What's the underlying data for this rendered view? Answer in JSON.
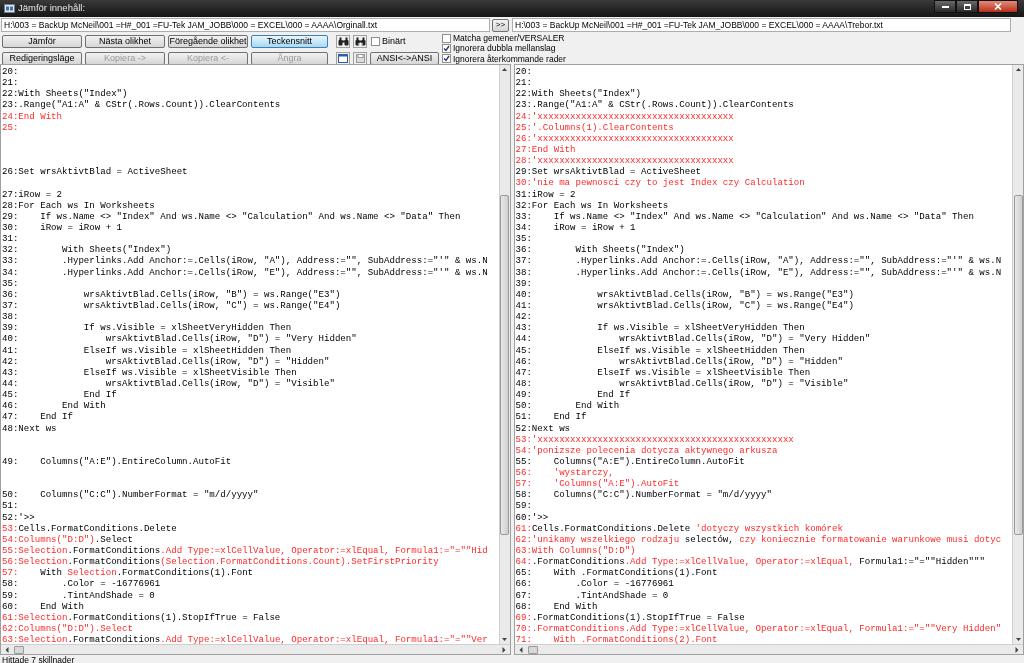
{
  "window": {
    "title": "Jämför innehåll:"
  },
  "paths": [
    {
      "value": "H:\\003 = BackUp McNeil\\001 =H#_001 =FU-Tek JAM_JOBB\\000 = EXCEL\\000 = AAAA\\Orginall.txt",
      "button": ">>"
    },
    {
      "value": "H:\\003 = BackUp McNeil\\001 =H#_001 =FU-Tek JAM_JOBB\\000 = EXCEL\\000 = AAAA\\Trebor.txt"
    }
  ],
  "toolbar_rows": [
    {
      "buttons": [
        {
          "label": "Jämför",
          "disabled": false,
          "focused": false
        },
        {
          "label": "Nästa olikhet",
          "disabled": false,
          "focused": false
        },
        {
          "label": "Föregående olikhet",
          "disabled": false,
          "focused": false
        },
        {
          "label": "Teckensnitt",
          "disabled": false,
          "focused": true
        }
      ],
      "checkbox": {
        "label": "Binärt",
        "checked": false
      }
    },
    {
      "buttons": [
        {
          "label": "Redigeringsläge",
          "disabled": false,
          "focused": false
        },
        {
          "label": "Kopiera ->",
          "disabled": true,
          "focused": false
        },
        {
          "label": "Kopiera <-",
          "disabled": true,
          "focused": false
        },
        {
          "label": "Ångra",
          "disabled": true,
          "focused": false
        }
      ],
      "extra_button": {
        "label": "ANSI<->ANSI"
      }
    }
  ],
  "options": [
    {
      "label": "Matcha gemener/VERSALER",
      "checked": false
    },
    {
      "label": "Ignorera dubbla mellanslag",
      "checked": true
    },
    {
      "label": "Ignorera återkommande rader",
      "checked": true
    }
  ],
  "panes": [
    {
      "lines": [
        {
          "kind": "line",
          "segments": [
            {
              "text": "20:",
              "changed": false
            }
          ]
        },
        {
          "kind": "line",
          "segments": [
            {
              "text": "21:",
              "changed": false
            }
          ]
        },
        {
          "kind": "line",
          "segments": [
            {
              "text": "22:With Sheets(\"Index\")",
              "changed": false
            }
          ]
        },
        {
          "kind": "line",
          "segments": [
            {
              "text": "23:.Range(\"A1:A\" & CStr(.Rows.Count)).ClearContents",
              "changed": false
            }
          ]
        },
        {
          "kind": "line",
          "segments": [
            {
              "text": "24:End With",
              "changed": true
            }
          ]
        },
        {
          "kind": "line",
          "segments": [
            {
              "text": "25:",
              "changed": true
            }
          ]
        },
        {
          "kind": "gap"
        },
        {
          "kind": "gap"
        },
        {
          "kind": "gap"
        },
        {
          "kind": "line",
          "segments": [
            {
              "text": "26:Set wrsAktivtBlad = ActiveSheet",
              "changed": false
            }
          ]
        },
        {
          "kind": "gap"
        },
        {
          "kind": "line",
          "segments": [
            {
              "text": "27:iRow = 2",
              "changed": false
            }
          ]
        },
        {
          "kind": "line",
          "segments": [
            {
              "text": "28:For Each ws In Worksheets",
              "changed": false
            }
          ]
        },
        {
          "kind": "line",
          "segments": [
            {
              "text": "29:    If ws.Name <> \"Index\" And ws.Name <> \"Calculation\" And ws.Name <> \"Data\" Then",
              "changed": false
            }
          ]
        },
        {
          "kind": "line",
          "segments": [
            {
              "text": "30:    iRow = iRow + 1",
              "changed": false
            }
          ]
        },
        {
          "kind": "line",
          "segments": [
            {
              "text": "31:",
              "changed": false
            }
          ]
        },
        {
          "kind": "line",
          "segments": [
            {
              "text": "32:        With Sheets(\"Index\")",
              "changed": false
            }
          ]
        },
        {
          "kind": "line",
          "segments": [
            {
              "text": "33:        .Hyperlinks.Add Anchor:=.Cells(iRow, \"A\"), Address:=\"\", SubAddress:=\"'\" & ws.N",
              "changed": false
            }
          ]
        },
        {
          "kind": "line",
          "segments": [
            {
              "text": "34:        .Hyperlinks.Add Anchor:=.Cells(iRow, \"E\"), Address:=\"\", SubAddress:=\"'\" & ws.N",
              "changed": false
            }
          ]
        },
        {
          "kind": "line",
          "segments": [
            {
              "text": "35:",
              "changed": false
            }
          ]
        },
        {
          "kind": "line",
          "segments": [
            {
              "text": "36:            wrsAktivtBlad.Cells(iRow, \"B\") = ws.Range(\"E3\")",
              "changed": false
            }
          ]
        },
        {
          "kind": "line",
          "segments": [
            {
              "text": "37:            wrsAktivtBlad.Cells(iRow, \"C\") = ws.Range(\"E4\")",
              "changed": false
            }
          ]
        },
        {
          "kind": "line",
          "segments": [
            {
              "text": "38:",
              "changed": false
            }
          ]
        },
        {
          "kind": "line",
          "segments": [
            {
              "text": "39:            If ws.Visible = xlSheetVeryHidden Then",
              "changed": false
            }
          ]
        },
        {
          "kind": "line",
          "segments": [
            {
              "text": "40:                wrsAktivtBlad.Cells(iRow, \"D\") = \"Very Hidden\"",
              "changed": false
            }
          ]
        },
        {
          "kind": "line",
          "segments": [
            {
              "text": "41:            ElseIf ws.Visible = xlSheetHidden Then",
              "changed": false
            }
          ]
        },
        {
          "kind": "line",
          "segments": [
            {
              "text": "42:                wrsAktivtBlad.Cells(iRow, \"D\") = \"Hidden\"",
              "changed": false
            }
          ]
        },
        {
          "kind": "line",
          "segments": [
            {
              "text": "43:            ElseIf ws.Visible = xlSheetVisible Then",
              "changed": false
            }
          ]
        },
        {
          "kind": "line",
          "segments": [
            {
              "text": "44:                wrsAktivtBlad.Cells(iRow, \"D\") = \"Visible\"",
              "changed": false
            }
          ]
        },
        {
          "kind": "line",
          "segments": [
            {
              "text": "45:            End If",
              "changed": false
            }
          ]
        },
        {
          "kind": "line",
          "segments": [
            {
              "text": "46:        End With",
              "changed": false
            }
          ]
        },
        {
          "kind": "line",
          "segments": [
            {
              "text": "47:    End If",
              "changed": false
            }
          ]
        },
        {
          "kind": "line",
          "segments": [
            {
              "text": "48:Next ws",
              "changed": false
            }
          ]
        },
        {
          "kind": "gap"
        },
        {
          "kind": "gap"
        },
        {
          "kind": "line",
          "segments": [
            {
              "text": "49:    Columns(\"A:E\").EntireColumn.AutoFit",
              "changed": false
            }
          ]
        },
        {
          "kind": "gap"
        },
        {
          "kind": "gap"
        },
        {
          "kind": "line",
          "segments": [
            {
              "text": "50:    Columns(\"C:C\").NumberFormat = \"m/d/yyyy\"",
              "changed": false
            }
          ]
        },
        {
          "kind": "line",
          "segments": [
            {
              "text": "51:",
              "changed": false
            }
          ]
        },
        {
          "kind": "line",
          "segments": [
            {
              "text": "52:'>>",
              "changed": false
            }
          ]
        },
        {
          "kind": "line",
          "segments": [
            {
              "text": "53:",
              "changed": true
            },
            {
              "text": "Cells.FormatConditions.Delete",
              "changed": false
            }
          ]
        },
        {
          "kind": "line",
          "segments": [
            {
              "text": "54:Columns(\"D:D\")",
              "changed": true
            },
            {
              "text": ".Select",
              "changed": false
            }
          ]
        },
        {
          "kind": "line",
          "segments": [
            {
              "text": "55:Selection",
              "changed": true
            },
            {
              "text": ".FormatConditions",
              "changed": false
            },
            {
              "text": ".Add Type:=xlCellValue, Operator:=xlEqual, Formula1:=\"=\"\"Hid",
              "changed": true
            }
          ]
        },
        {
          "kind": "line",
          "segments": [
            {
              "text": "56:Selection",
              "changed": true
            },
            {
              "text": ".FormatConditions",
              "changed": false
            },
            {
              "text": "(Selection.FormatConditions.Count).SetFirstPriority",
              "changed": true
            }
          ]
        },
        {
          "kind": "line",
          "segments": [
            {
              "text": "57:",
              "changed": true
            },
            {
              "text": "    With ",
              "changed": false
            },
            {
              "text": "Selection",
              "changed": true
            },
            {
              "text": ".FormatConditions(1).Font",
              "changed": false
            }
          ]
        },
        {
          "kind": "line",
          "segments": [
            {
              "text": "58:        .Color = -16776961",
              "changed": false
            }
          ]
        },
        {
          "kind": "line",
          "segments": [
            {
              "text": "59:        .TintAndShade = 0",
              "changed": false
            }
          ]
        },
        {
          "kind": "line",
          "segments": [
            {
              "text": "60:    End With",
              "changed": false
            }
          ]
        },
        {
          "kind": "line",
          "segments": [
            {
              "text": "61:Selection",
              "changed": true
            },
            {
              "text": ".FormatConditions(1).StopIfTrue = False",
              "changed": false
            }
          ]
        },
        {
          "kind": "line",
          "segments": [
            {
              "text": "62:Columns(\"D:D\").Select",
              "changed": true
            }
          ]
        },
        {
          "kind": "line",
          "segments": [
            {
              "text": "63:Selection",
              "changed": true
            },
            {
              "text": ".FormatConditions",
              "changed": false
            },
            {
              "text": ".Add Type:=xlCellValue, Operator:=xlEqual, Formula1:=\"=\"\"Ver",
              "changed": true
            }
          ]
        }
      ]
    },
    {
      "lines": [
        {
          "kind": "line",
          "segments": [
            {
              "text": "20:",
              "changed": false
            }
          ]
        },
        {
          "kind": "line",
          "segments": [
            {
              "text": "21:",
              "changed": false
            }
          ]
        },
        {
          "kind": "line",
          "segments": [
            {
              "text": "22:With Sheets(\"Index\")",
              "changed": false
            }
          ]
        },
        {
          "kind": "line",
          "segments": [
            {
              "text": "23:.Range(\"A1:A\" & CStr(.Rows.Count)).ClearContents",
              "changed": false
            }
          ]
        },
        {
          "kind": "line",
          "segments": [
            {
              "text": "24:'xxxxxxxxxxxxxxxxxxxxxxxxxxxxxxxxxxxx",
              "changed": true
            }
          ]
        },
        {
          "kind": "line",
          "segments": [
            {
              "text": "25:'.Columns(1).ClearContents",
              "changed": true
            }
          ]
        },
        {
          "kind": "line",
          "segments": [
            {
              "text": "26:'xxxxxxxxxxxxxxxxxxxxxxxxxxxxxxxxxxxx",
              "changed": true
            }
          ]
        },
        {
          "kind": "line",
          "segments": [
            {
              "text": "27:End With",
              "changed": true
            }
          ]
        },
        {
          "kind": "line",
          "segments": [
            {
              "text": "28:'xxxxxxxxxxxxxxxxxxxxxxxxxxxxxxxxxxxx",
              "changed": true
            }
          ]
        },
        {
          "kind": "line",
          "segments": [
            {
              "text": "29:Set wrsAktivtBlad = ActiveSheet",
              "changed": false
            }
          ]
        },
        {
          "kind": "line",
          "segments": [
            {
              "text": "30:'nie ma pewnosci czy to jest Index czy Calculation",
              "changed": true
            }
          ]
        },
        {
          "kind": "line",
          "segments": [
            {
              "text": "31:iRow = 2",
              "changed": false
            }
          ]
        },
        {
          "kind": "line",
          "segments": [
            {
              "text": "32:For Each ws In Worksheets",
              "changed": false
            }
          ]
        },
        {
          "kind": "line",
          "segments": [
            {
              "text": "33:    If ws.Name <> \"Index\" And ws.Name <> \"Calculation\" And ws.Name <> \"Data\" Then",
              "changed": false
            }
          ]
        },
        {
          "kind": "line",
          "segments": [
            {
              "text": "34:    iRow = iRow + 1",
              "changed": false
            }
          ]
        },
        {
          "kind": "line",
          "segments": [
            {
              "text": "35:",
              "changed": false
            }
          ]
        },
        {
          "kind": "line",
          "segments": [
            {
              "text": "36:        With Sheets(\"Index\")",
              "changed": false
            }
          ]
        },
        {
          "kind": "line",
          "segments": [
            {
              "text": "37:        .Hyperlinks.Add Anchor:=.Cells(iRow, \"A\"), Address:=\"\", SubAddress:=\"'\" & ws.N",
              "changed": false
            }
          ]
        },
        {
          "kind": "line",
          "segments": [
            {
              "text": "38:        .Hyperlinks.Add Anchor:=.Cells(iRow, \"E\"), Address:=\"\", SubAddress:=\"'\" & ws.N",
              "changed": false
            }
          ]
        },
        {
          "kind": "line",
          "segments": [
            {
              "text": "39:",
              "changed": false
            }
          ]
        },
        {
          "kind": "line",
          "segments": [
            {
              "text": "40:            wrsAktivtBlad.Cells(iRow, \"B\") = ws.Range(\"E3\")",
              "changed": false
            }
          ]
        },
        {
          "kind": "line",
          "segments": [
            {
              "text": "41:            wrsAktivtBlad.Cells(iRow, \"C\") = ws.Range(\"E4\")",
              "changed": false
            }
          ]
        },
        {
          "kind": "line",
          "segments": [
            {
              "text": "42:",
              "changed": false
            }
          ]
        },
        {
          "kind": "line",
          "segments": [
            {
              "text": "43:            If ws.Visible = xlSheetVeryHidden Then",
              "changed": false
            }
          ]
        },
        {
          "kind": "line",
          "segments": [
            {
              "text": "44:                wrsAktivtBlad.Cells(iRow, \"D\") = \"Very Hidden\"",
              "changed": false
            }
          ]
        },
        {
          "kind": "line",
          "segments": [
            {
              "text": "45:            ElseIf ws.Visible = xlSheetHidden Then",
              "changed": false
            }
          ]
        },
        {
          "kind": "line",
          "segments": [
            {
              "text": "46:                wrsAktivtBlad.Cells(iRow, \"D\") = \"Hidden\"",
              "changed": false
            }
          ]
        },
        {
          "kind": "line",
          "segments": [
            {
              "text": "47:            ElseIf ws.Visible = xlSheetVisible Then",
              "changed": false
            }
          ]
        },
        {
          "kind": "line",
          "segments": [
            {
              "text": "48:                wrsAktivtBlad.Cells(iRow, \"D\") = \"Visible\"",
              "changed": false
            }
          ]
        },
        {
          "kind": "line",
          "segments": [
            {
              "text": "49:            End If",
              "changed": false
            }
          ]
        },
        {
          "kind": "line",
          "segments": [
            {
              "text": "50:        End With",
              "changed": false
            }
          ]
        },
        {
          "kind": "line",
          "segments": [
            {
              "text": "51:    End If",
              "changed": false
            }
          ]
        },
        {
          "kind": "line",
          "segments": [
            {
              "text": "52:Next ws",
              "changed": false
            }
          ]
        },
        {
          "kind": "line",
          "segments": [
            {
              "text": "53:'xxxxxxxxxxxxxxxxxxxxxxxxxxxxxxxxxxxxxxxxxxxxxxx",
              "changed": true
            }
          ]
        },
        {
          "kind": "line",
          "segments": [
            {
              "text": "54:'ponizsze polecenia dotycza aktywnego arkusza",
              "changed": true
            }
          ]
        },
        {
          "kind": "line",
          "segments": [
            {
              "text": "55:    Columns(\"A:E\").EntireColumn.AutoFit",
              "changed": false
            }
          ]
        },
        {
          "kind": "line",
          "segments": [
            {
              "text": "56:    'wystarczy,",
              "changed": true
            }
          ]
        },
        {
          "kind": "line",
          "segments": [
            {
              "text": "57:    'Columns(\"A:E\").AutoFit",
              "changed": true
            }
          ]
        },
        {
          "kind": "line",
          "segments": [
            {
              "text": "58:    Columns(\"C:C\").NumberFormat = \"m/d/yyyy\"",
              "changed": false
            }
          ]
        },
        {
          "kind": "line",
          "segments": [
            {
              "text": "59:",
              "changed": false
            }
          ]
        },
        {
          "kind": "line",
          "segments": [
            {
              "text": "60:'>>",
              "changed": false
            }
          ]
        },
        {
          "kind": "line",
          "segments": [
            {
              "text": "61:",
              "changed": true
            },
            {
              "text": "Cells.FormatConditions.Delete ",
              "changed": false
            },
            {
              "text": "'dotyczy wszystkich komórek",
              "changed": true
            }
          ]
        },
        {
          "kind": "line",
          "segments": [
            {
              "text": "62:'unikamy wszelkiego rodzaju ",
              "changed": true
            },
            {
              "text": "selectów,",
              "changed": false
            },
            {
              "text": " czy koniecznie formatowanie warunkowe musi dotyc",
              "changed": true
            }
          ]
        },
        {
          "kind": "line",
          "segments": [
            {
              "text": "63:With Columns(\"D:D\")",
              "changed": true
            }
          ]
        },
        {
          "kind": "line",
          "segments": [
            {
              "text": "64:",
              "changed": true
            },
            {
              "text": ".FormatConditions",
              "changed": false
            },
            {
              "text": ".Add Type:=xlCellValue, Operator:=xlEqual, ",
              "changed": true
            },
            {
              "text": "Formula1:=\"=\"\"Hidden\"\"\"",
              "changed": false
            }
          ]
        },
        {
          "kind": "line",
          "segments": [
            {
              "text": "65:    With .FormatConditions(1).Font",
              "changed": false
            }
          ]
        },
        {
          "kind": "line",
          "segments": [
            {
              "text": "66:        .Color = -16776961",
              "changed": false
            }
          ]
        },
        {
          "kind": "line",
          "segments": [
            {
              "text": "67:        .TintAndShade = 0",
              "changed": false
            }
          ]
        },
        {
          "kind": "line",
          "segments": [
            {
              "text": "68:    End With",
              "changed": false
            }
          ]
        },
        {
          "kind": "line",
          "segments": [
            {
              "text": "69:",
              "changed": true
            },
            {
              "text": ".FormatConditions(1).StopIfTrue = False",
              "changed": false
            }
          ]
        },
        {
          "kind": "line",
          "segments": [
            {
              "text": "70:.FormatConditions.Add Type:=xlCellValue, Operator:=xlEqual, Formula1:=\"=\"\"Very Hidden\"",
              "changed": true
            }
          ]
        },
        {
          "kind": "line",
          "segments": [
            {
              "text": "71:    With .FormatConditions(2).Font",
              "changed": true
            }
          ]
        }
      ]
    }
  ],
  "status_bar": {
    "text": "Hittade 7 skillnader"
  }
}
